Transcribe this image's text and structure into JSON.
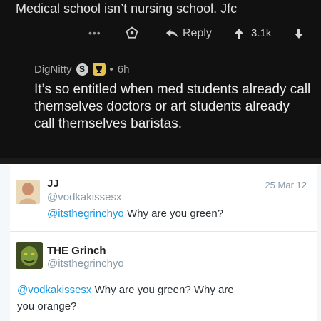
{
  "reddit": {
    "parent_comment": "Medical school isn’t nursing school. Jfc",
    "more_label": "•••",
    "reply_label": "Reply",
    "score": "3.1k",
    "username": "DigNitty",
    "badge_letter": "S",
    "age": "6h",
    "comment": "It’s so entitled when med students already call themselves doctors or art students already call themselves baristas."
  },
  "twitter": {
    "tweet1": {
      "name": "JJ",
      "handle": "@vodkakissesx",
      "date": "25 Mar 12",
      "mention": "@itsthegrinchyo",
      "text": " Why are you green?"
    },
    "tweet2": {
      "name": "THE Grinch",
      "handle": "@itsthegrinchyo",
      "mention": "@vodkakissesx",
      "text": " Why are you green? Why are you orange?"
    }
  },
  "colors": {
    "reddit_bg": "#111111",
    "twitter_link": "#1b95e0",
    "twitter_muted": "#8899a6"
  }
}
